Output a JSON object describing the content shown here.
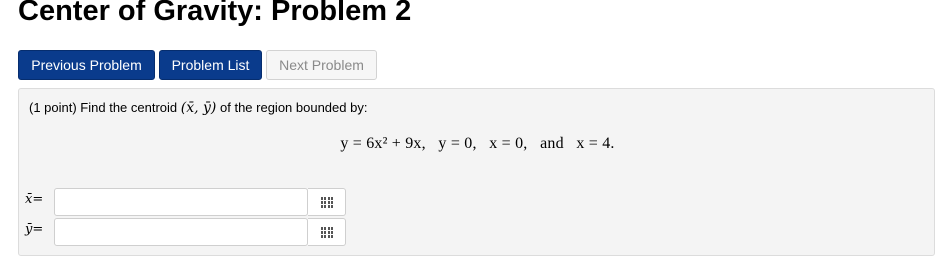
{
  "page": {
    "title": "Center of Gravity: Problem 2"
  },
  "nav": {
    "previous_label": "Previous Problem",
    "list_label": "Problem List",
    "next_label": "Next Problem"
  },
  "problem": {
    "prompt_prefix": "(1 point) Find the centroid ",
    "centroid_symbol": "(x̄, ȳ)",
    "prompt_suffix": " of the region bounded by:",
    "equation": "y = 6x² + 9x,   y = 0,   x = 0,   and   x = 4."
  },
  "answers": [
    {
      "label": "x̄=",
      "value": "",
      "icon": "equation-palette-icon"
    },
    {
      "label": "ȳ=",
      "value": "",
      "icon": "equation-palette-icon"
    }
  ],
  "colors": {
    "primary_button": "#0a3b8c",
    "disabled_button_text": "#8a8a8a",
    "panel_background": "#f4f4f4"
  }
}
